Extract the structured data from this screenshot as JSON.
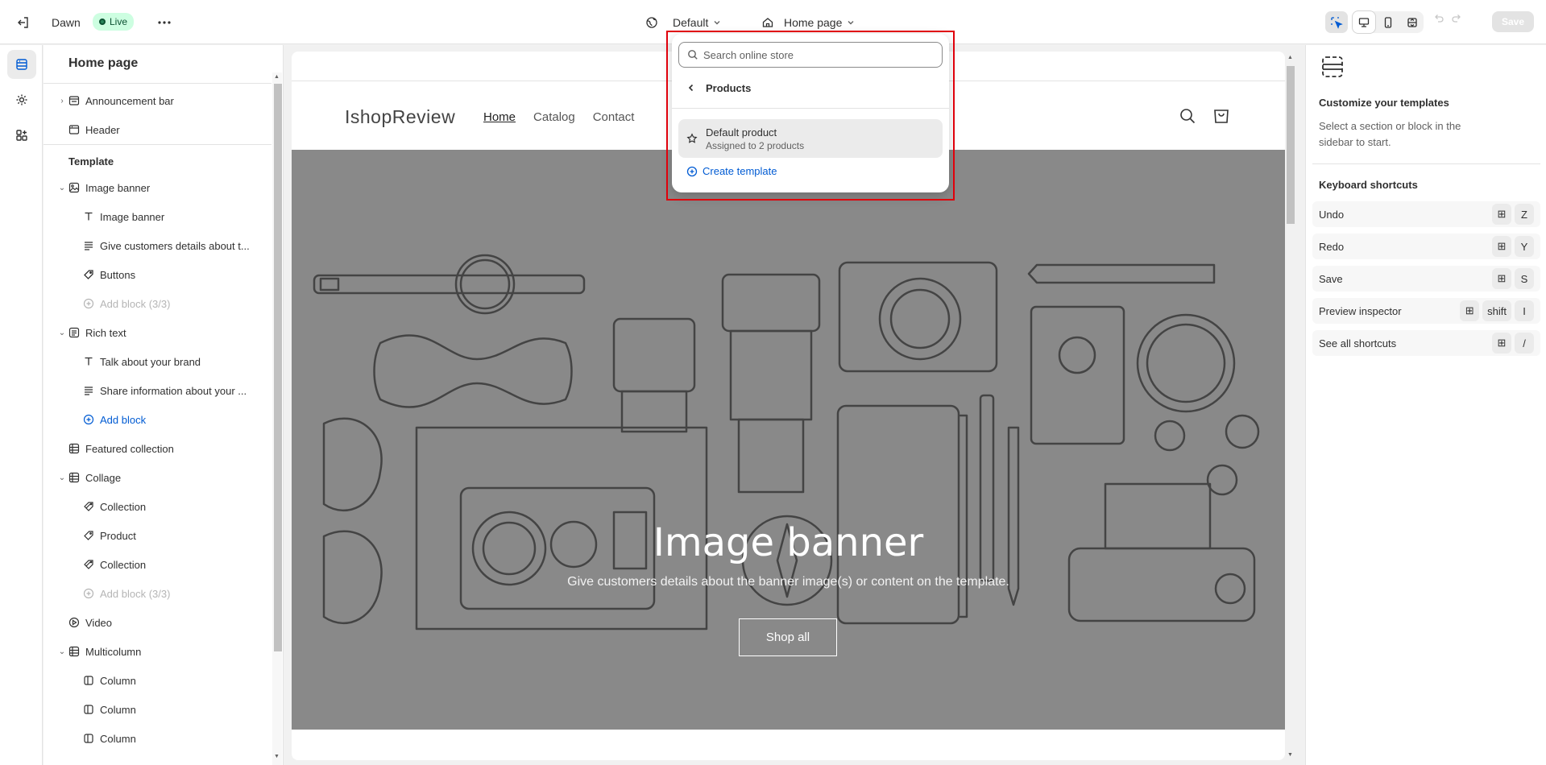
{
  "topbar": {
    "theme_name": "Dawn",
    "live_label": "Live",
    "theme_select": "Default",
    "page_select": "Home page",
    "save_label": "Save"
  },
  "sidebar": {
    "title": "Home page",
    "items": [
      {
        "label": "Announcement bar"
      },
      {
        "label": "Header"
      }
    ],
    "template_label": "Template",
    "template_items": [
      {
        "label": "Image banner"
      },
      {
        "label": "Image banner"
      },
      {
        "label": "Give customers details about t..."
      },
      {
        "label": "Buttons"
      },
      {
        "label": "Add block (3/3)"
      },
      {
        "label": "Rich text"
      },
      {
        "label": "Talk about your brand"
      },
      {
        "label": "Share information about your ..."
      },
      {
        "label": "Add block"
      },
      {
        "label": "Featured collection"
      },
      {
        "label": "Collage"
      },
      {
        "label": "Collection"
      },
      {
        "label": "Product"
      },
      {
        "label": "Collection"
      },
      {
        "label": "Add block (3/3)"
      },
      {
        "label": "Video"
      },
      {
        "label": "Multicolumn"
      },
      {
        "label": "Column"
      },
      {
        "label": "Column"
      },
      {
        "label": "Column"
      }
    ]
  },
  "store": {
    "logo": "IshopReview",
    "nav": [
      "Home",
      "Catalog",
      "Contact"
    ],
    "banner_title": "Image banner",
    "banner_subtitle": "Give customers details about the banner image(s) or content on the template.",
    "banner_button": "Shop all"
  },
  "popover": {
    "search_placeholder": "Search online store",
    "back_label": "Products",
    "item_title": "Default product",
    "item_subtitle": "Assigned to 2 products",
    "create_label": "Create template"
  },
  "right_panel": {
    "title": "Customize your templates",
    "description": "Select a section or block in the sidebar to start.",
    "shortcuts_title": "Keyboard shortcuts",
    "shortcuts": [
      {
        "label": "Undo",
        "keys": [
          "⊞",
          "Z"
        ]
      },
      {
        "label": "Redo",
        "keys": [
          "⊞",
          "Y"
        ]
      },
      {
        "label": "Save",
        "keys": [
          "⊞",
          "S"
        ]
      },
      {
        "label": "Preview inspector",
        "keys": [
          "⊞",
          "shift",
          "I"
        ]
      },
      {
        "label": "See all shortcuts",
        "keys": [
          "⊞",
          "/"
        ]
      }
    ]
  },
  "colors": {
    "accent": "#005bd3",
    "live_bg": "#cdfee1",
    "highlight_border": "#e0000b",
    "banner_bg": "#898989"
  }
}
